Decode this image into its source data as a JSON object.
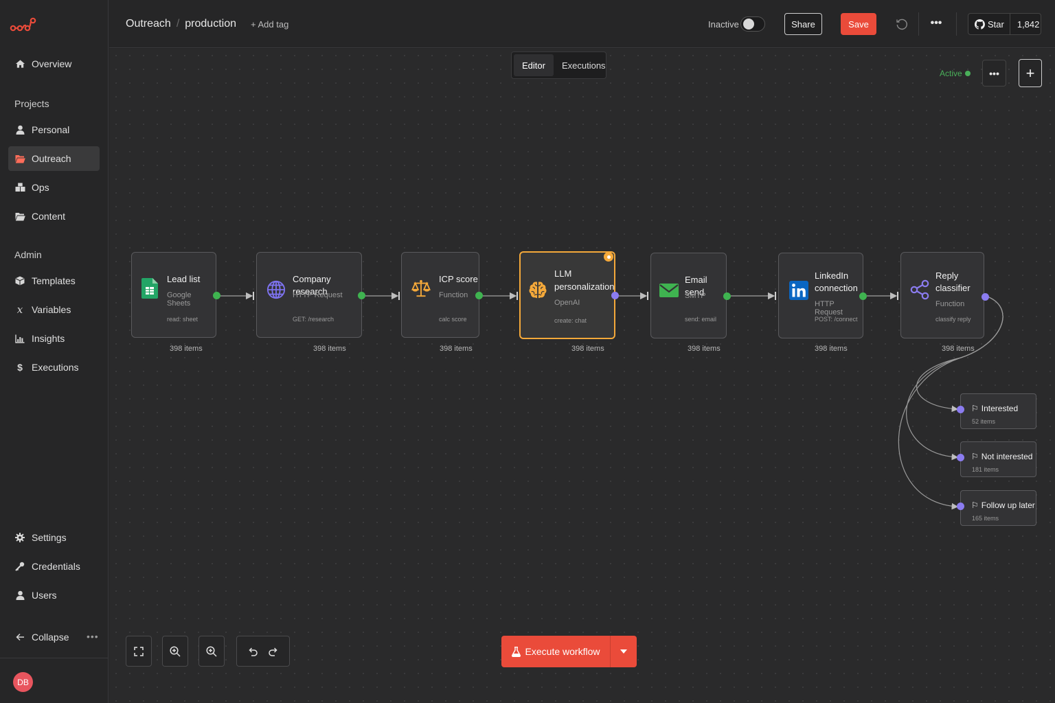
{
  "sidebar": {
    "overview": "Overview",
    "projects_heading": "Projects",
    "projects": [
      {
        "label": "Personal",
        "icon": "user-icon"
      },
      {
        "label": "Outreach",
        "icon": "folder-open-icon",
        "active": true
      },
      {
        "label": "Ops",
        "icon": "boxes-icon"
      },
      {
        "label": "Content",
        "icon": "folder-icon"
      }
    ],
    "admin_heading": "Admin",
    "admin": [
      {
        "label": "Templates",
        "icon": "box-icon"
      },
      {
        "label": "Variables",
        "icon": "variable-icon"
      },
      {
        "label": "Insights",
        "icon": "chart-icon"
      },
      {
        "label": "Executions",
        "icon": "dollar-icon"
      }
    ],
    "bottom": [
      {
        "label": "Settings",
        "icon": "gear-icon"
      },
      {
        "label": "Credentials",
        "icon": "key-icon"
      },
      {
        "label": "Users",
        "icon": "user-icon"
      }
    ],
    "collapse": "Collapse",
    "avatar_initials": "DB"
  },
  "header": {
    "project": "Outreach",
    "separator": "/",
    "workflow": "production",
    "add_tag": "+ Add tag",
    "inactive_label": "Inactive",
    "share": "Share",
    "save": "Save",
    "more": "•••",
    "star_label": "Star",
    "star_count": "1,842"
  },
  "canvas": {
    "tabs": {
      "editor": "Editor",
      "executions": "Executions"
    },
    "active_label": "Active",
    "more": "•••",
    "add": "+",
    "nodes": [
      {
        "title1": "Lead list",
        "title2": "",
        "sub": "Google Sheets",
        "param": "read: sheet",
        "items": "398 items",
        "icon": "google-sheets-icon"
      },
      {
        "title1": "Company research",
        "title2": "",
        "sub": "HTTP Request",
        "param": "GET: /research",
        "items": "398 items",
        "icon": "globe-icon"
      },
      {
        "title1": "ICP score",
        "title2": "",
        "sub": "Function",
        "param": "calc score",
        "items": "398 items",
        "icon": "scale-icon"
      },
      {
        "title1": "LLM",
        "title2": "personalization",
        "sub": "OpenAI",
        "param": "create: chat",
        "items": "398 items",
        "icon": "brain-icon"
      },
      {
        "title1": "Email send",
        "title2": "",
        "sub": "SMTP",
        "param": "send: email",
        "items": "398 items",
        "icon": "envelope-icon"
      },
      {
        "title1": "LinkedIn",
        "title2": "connection",
        "sub": "HTTP Request",
        "param": "POST: /connect",
        "items": "398 items",
        "icon": "linkedin-icon"
      },
      {
        "title1": "Reply",
        "title2": "classifier",
        "sub": "Function",
        "param": "classify reply",
        "items": "398 items",
        "icon": "share-nodes-icon"
      }
    ],
    "branches": [
      {
        "label": "Interested",
        "count": "52 items"
      },
      {
        "label": "Not interested",
        "count": "181 items"
      },
      {
        "label": "Follow up later",
        "count": "165 items"
      }
    ],
    "execute": "Execute workflow",
    "colors": {
      "accent": "#ea4b3a",
      "success": "#3fb350",
      "ai_port": "#8b7cf0",
      "selected": "#f5a93a"
    }
  }
}
